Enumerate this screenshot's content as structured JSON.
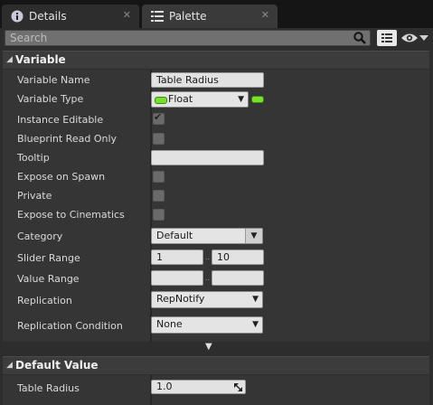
{
  "tabs": [
    {
      "label": "Details",
      "icon": "details-info-icon",
      "close": "✕"
    },
    {
      "label": "Palette",
      "icon": "palette-list-icon",
      "close": "✕"
    }
  ],
  "search": {
    "placeholder": "Search"
  },
  "variable_section": {
    "title": "Variable",
    "rows": {
      "variable_name": {
        "label": "Variable Name",
        "value": "Table Radius"
      },
      "variable_type": {
        "label": "Variable Type",
        "value": "Float",
        "pin_color": "#7adf2d"
      },
      "instance_editable": {
        "label": "Instance Editable",
        "checked": true
      },
      "blueprint_read_only": {
        "label": "Blueprint Read Only",
        "checked": false
      },
      "tooltip": {
        "label": "Tooltip",
        "value": ""
      },
      "expose_on_spawn": {
        "label": "Expose on Spawn",
        "checked": false
      },
      "private": {
        "label": "Private",
        "checked": false
      },
      "expose_to_cinematics": {
        "label": "Expose to Cinematics",
        "checked": false
      },
      "category": {
        "label": "Category",
        "value": "Default"
      },
      "slider_range": {
        "label": "Slider Range",
        "min": "1",
        "max": "10",
        "separator": ".."
      },
      "value_range": {
        "label": "Value Range",
        "min": "",
        "max": "",
        "separator": ".."
      },
      "replication": {
        "label": "Replication",
        "value": "RepNotify"
      },
      "replication_condition": {
        "label": "Replication Condition",
        "value": "None"
      }
    }
  },
  "default_value_section": {
    "title": "Default Value",
    "rows": {
      "table_radius": {
        "label": "Table Radius",
        "value": "1.0"
      }
    }
  }
}
